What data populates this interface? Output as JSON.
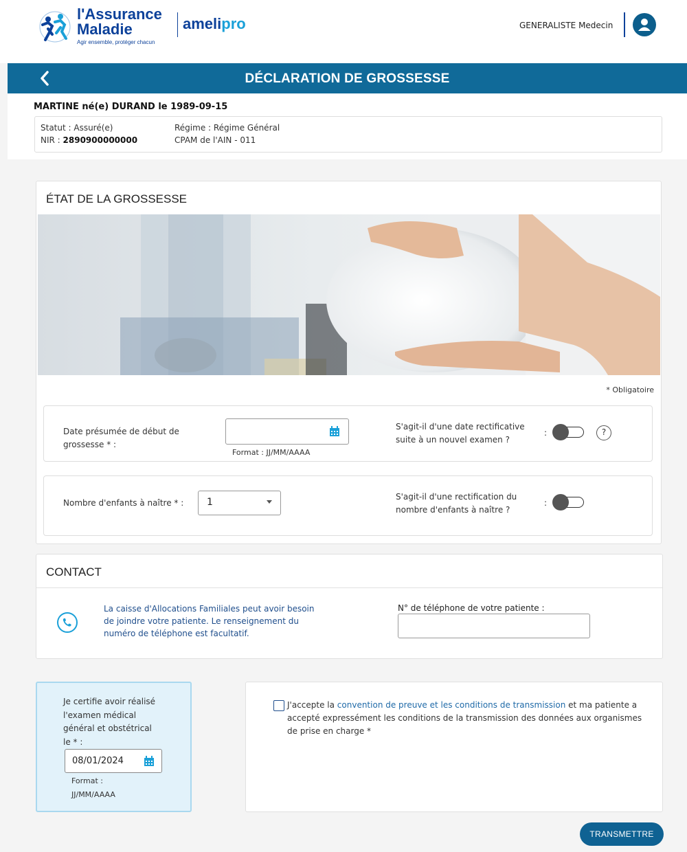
{
  "header": {
    "logo_line1": "l'Assurance",
    "logo_line2": "Maladie",
    "logo_tagline": "Agir ensemble, protéger chacun",
    "amelipro_part1": "ameli",
    "amelipro_part2": "pro",
    "user_label": "GENERALISTE Medecin",
    "avatar_icon": "user-icon"
  },
  "titlebar": {
    "title": "DÉCLARATION DE GROSSESSE",
    "back_icon": "chevron-left-icon"
  },
  "patient": {
    "name_line": "MARTINE  né(e) DURAND  le 1989-09-15",
    "statut_label": "Statut : Assuré(e)",
    "nir_label": "NIR : ",
    "nir_value": "2890900000000",
    "regime_label": "Régime : Régime Général",
    "cpam_label": "CPAM de l'AIN - 011"
  },
  "etat": {
    "title": "ÉTAT DE LA GROSSESSE",
    "mandatory_note": "* Obligatoire",
    "date_label_1": "Date présumée de début de",
    "date_label_2": "grossesse * :",
    "date_value": "",
    "date_format": "Format : JJ/MM/AAAA",
    "rectif_date_label_1": "S'agit-il d'une date rectificative",
    "rectif_date_label_2": "suite à un nouvel examen ?",
    "rectif_date_on": false,
    "help_label": "?",
    "enfants_label": "Nombre d'enfants à naître * :",
    "enfants_value": "1",
    "rectif_enfants_label_1": "S'agit-il d'une rectification du",
    "rectif_enfants_label_2": "nombre d'enfants à naître ?",
    "rectif_enfants_on": false,
    "colon": ":"
  },
  "contact": {
    "title": "CONTACT",
    "info_line1": "La caisse d'Allocations Familiales peut avoir besoin",
    "info_line2": "de joindre votre patiente. Le renseignement du",
    "info_line3": "numéro de téléphone est facultatif.",
    "phone_label": "N° de téléphone de votre patiente  :",
    "phone_value": ""
  },
  "certification": {
    "line1": "Je certifie avoir réalisé",
    "line2": "l'examen médical",
    "line3": "général et obstétrical",
    "line4": "le * :",
    "date_value": "08/01/2024",
    "format_label": "Format :",
    "format_value": "JJ/MM/AAAA"
  },
  "acceptance": {
    "checked": false,
    "text_before": "J'accepte la ",
    "link_text": "convention de preuve et les conditions de transmission",
    "text_after": " et ma patiente a accepté expressément les conditions de la transmission des données aux organismes de prise en charge *"
  },
  "actions": {
    "submit_label": "TRANSMETTRE"
  }
}
